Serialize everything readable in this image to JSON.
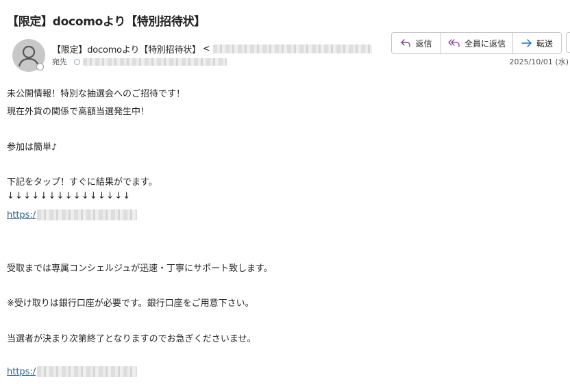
{
  "email": {
    "subject": "【限定】docomoより【特別招待状】",
    "sender_name": "【限定】docomoより【特別招待状】",
    "sender_angle": "<",
    "to_label": "宛先",
    "date": "2025/10/01 (水)"
  },
  "toolbar": {
    "reply_label": "返信",
    "reply_all_label": "全員に返信",
    "forward_label": "転送"
  },
  "body": {
    "line1": "未公開情報！特別な抽選会へのご招待です！",
    "line2": "現在外貨の関係で高額当選発生中！",
    "line3": "参加は簡単♪",
    "line4": "下記をタップ！すぐに結果がでます。",
    "arrows": "↓↓↓↓↓↓↓↓↓↓↓↓↓↓↓",
    "link1": "https:/",
    "line5": "受取までは専属コンシェルジュが迅速・丁寧にサポート致します。",
    "line6": "※受け取りは銀行口座が必要です。銀行口座をご用意下さい。",
    "line7": "当選者が決まり次第終了となりますのでお急ぎくださいませ。",
    "link2": "https:/"
  },
  "colors": {
    "link": "#2f5f8a",
    "reply_icon": "#8a3a9c",
    "forward_icon": "#1f6fb2"
  }
}
